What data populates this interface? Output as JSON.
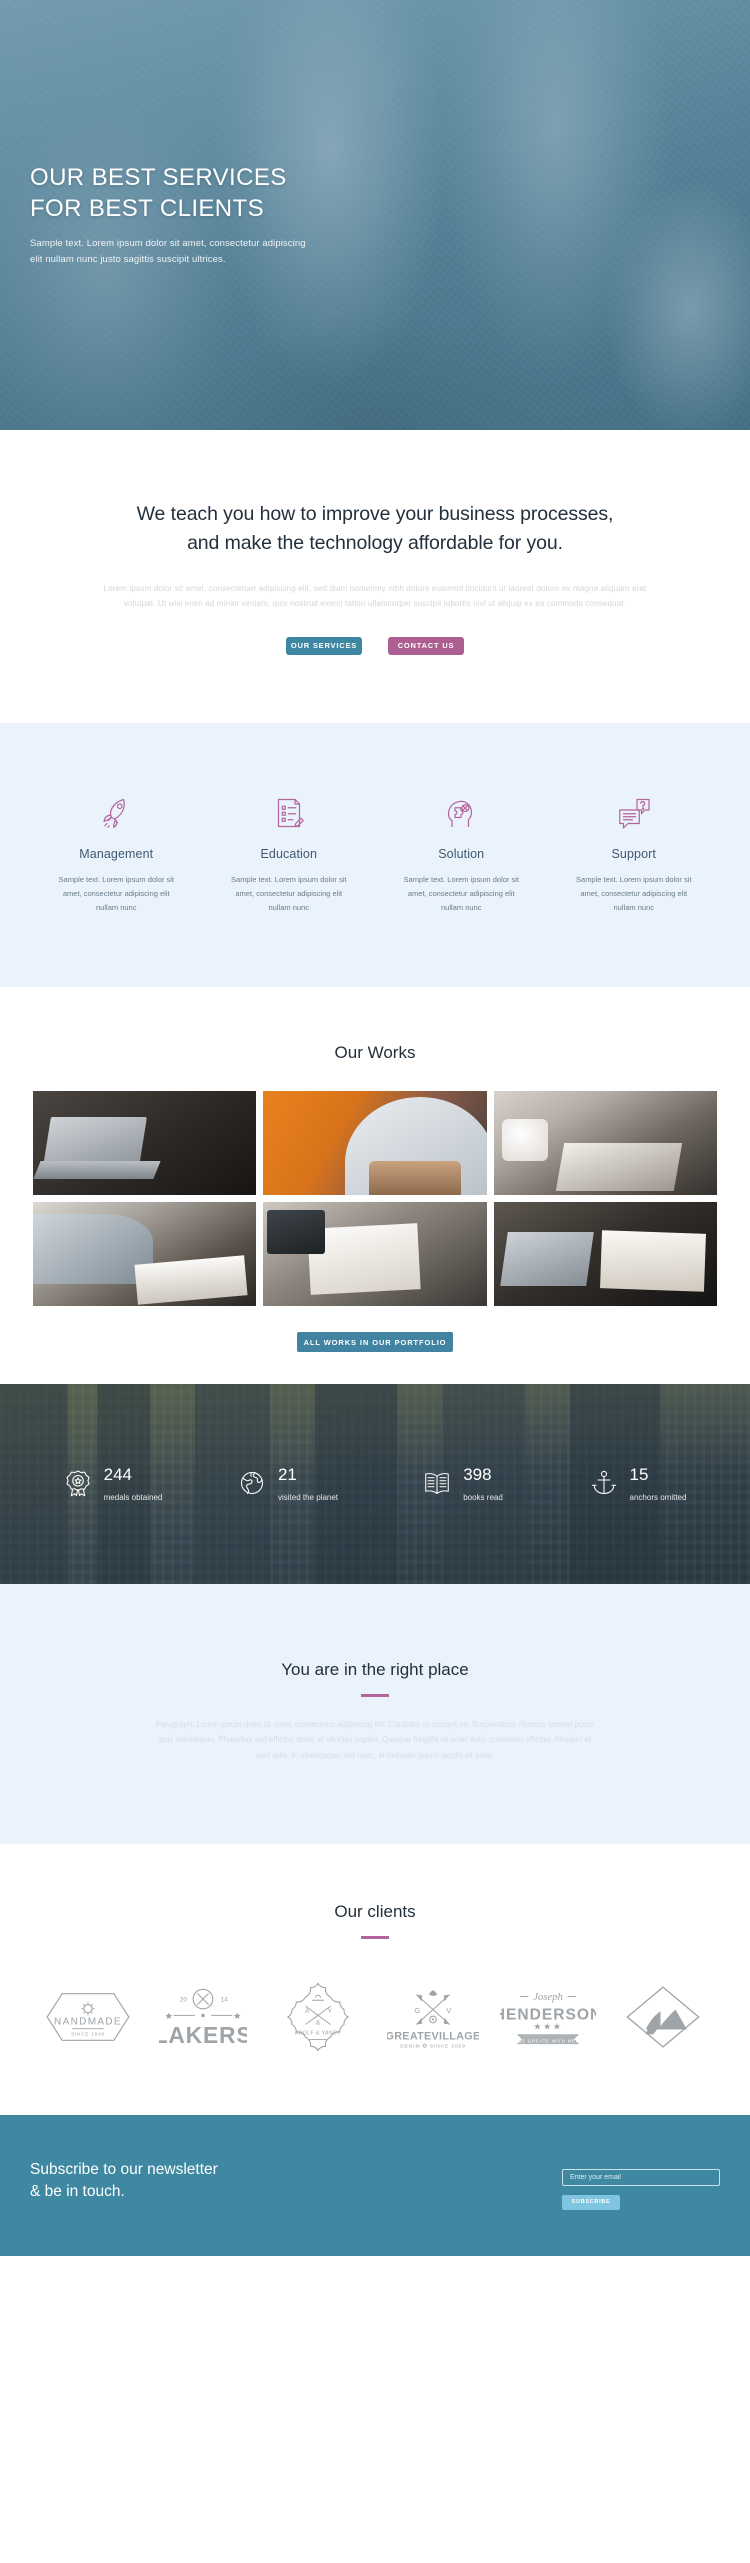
{
  "hero": {
    "title_line1": "OUR BEST SERVICES",
    "title_line2": "FOR BEST CLIENTS",
    "subtitle": "Sample text. Lorem ipsum dolor sit amet, consectetur adipiscing elit nullam nunc justo sagittis suscipit ultrices."
  },
  "intro": {
    "heading_line1": "We teach you how to improve your business processes,",
    "heading_line2": "and make the technology affordable for you.",
    "body": "Lorem ipsum dolor sit amet, consectetuer adipiscing elit, sed diam nonummy nibh dolore  euismod tincidunt ut laoreet dolore ex magna aliquam erat volutpat. Ut wisi enim ad minim veniam, quis nostrud exerci tation ullamcorper suscipit lobortis nisl ut aliquip ex ea commodo consequat.",
    "btn_primary": "OUR SERVICES",
    "btn_accent": "CONTACT US"
  },
  "features": {
    "items": [
      {
        "icon": "rocket-icon",
        "title": "Management",
        "text": "Sample text. Lorem ipsum dolor sit amet, consectetur adipiscing elit nullam nunc"
      },
      {
        "icon": "checklist-icon",
        "title": "Education",
        "text": "Sample text. Lorem ipsum dolor sit amet, consectetur adipiscing elit nullam nunc"
      },
      {
        "icon": "head-puzzle-icon",
        "title": "Solution",
        "text": "Sample text. Lorem ipsum dolor sit amet, consectetur adipiscing elit nullam nunc"
      },
      {
        "icon": "chat-question-icon",
        "title": "Support",
        "text": "Sample text. Lorem ipsum dolor sit amet, consectetur adipiscing elit nullam nunc"
      }
    ]
  },
  "works": {
    "heading": "Our Works",
    "button": "ALL WORKS IN OUR PORTFOLIO",
    "tiles": [
      {
        "name": "work-laptop-desk"
      },
      {
        "name": "work-man-writing"
      },
      {
        "name": "work-meeting-table"
      },
      {
        "name": "work-hand-notebook"
      },
      {
        "name": "work-books-desk"
      },
      {
        "name": "work-laptop-notepad"
      }
    ]
  },
  "counters": {
    "items": [
      {
        "icon": "medal-icon",
        "value": "244",
        "label": "medals obtained"
      },
      {
        "icon": "globe-icon",
        "value": "21",
        "label": "visited the planet"
      },
      {
        "icon": "book-icon",
        "value": "398",
        "label": "books read"
      },
      {
        "icon": "anchor-icon",
        "value": "15",
        "label": "anchors omitted"
      }
    ]
  },
  "rightplace": {
    "heading": "You are in the right place",
    "body": "Paragraph. Lorem ipsum dolor sit amet, consectetur adipiscing elit. Curabitur id suscipit ex. Suspendisse rhoncus laoreet purus quis elementum. Phasellus sed efficitur dolor, et ultricies sapien. Quisque fringilla sit amet dolor commodo efficitur. Aliquam et sem odio. In ullamcorper nisi nunc, et molestie ipsum iaculis sit amet."
  },
  "clients": {
    "heading": "Our clients",
    "logos": [
      {
        "name": "client-logo-nandmade",
        "text": "NANDMADE",
        "sub": "SINCE 1998"
      },
      {
        "name": "client-logo-lakers",
        "text": "LAKERS",
        "sub": "20   14"
      },
      {
        "name": "client-logo-adolf-yancy",
        "text": "ADOLF & YANCY",
        "sub": "A  Y  &"
      },
      {
        "name": "client-logo-greatvillage",
        "text": "GREATEVILLAGE",
        "sub": "DENIM  SINCE 2009"
      },
      {
        "name": "client-logo-henderson",
        "text": "HENDERSON",
        "sub": "Joseph"
      },
      {
        "name": "client-logo-diamond",
        "text": "",
        "sub": ""
      }
    ]
  },
  "footer": {
    "heading_line1": "Subscribe to our newsletter",
    "heading_line2": "& be in touch.",
    "input_placeholder": "Enter your email",
    "button": "SUBSCRIBE"
  },
  "colors": {
    "accent_blue": "#3d87a3",
    "accent_pink": "#ad5f92",
    "footer_blue": "#3f88a2",
    "pale_blue_bg": "#eaf2fb",
    "subscribe_btn": "#7fc4e0"
  }
}
